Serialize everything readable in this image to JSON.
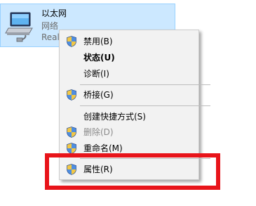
{
  "adapter": {
    "name": "以太网",
    "status": "网络",
    "device": "Real",
    "icon": "network-adapter-icon"
  },
  "context_menu": {
    "items": [
      {
        "label": "禁用(B)",
        "icon": "uac-shield-icon",
        "bold": false,
        "disabled": false
      },
      {
        "label": "状态(U)",
        "icon": null,
        "bold": true,
        "disabled": false
      },
      {
        "label": "诊断(I)",
        "icon": null,
        "bold": false,
        "disabled": false
      },
      {
        "label": "桥接(G)",
        "icon": "uac-shield-icon",
        "bold": false,
        "disabled": false
      },
      {
        "label": "创建快捷方式(S)",
        "icon": null,
        "bold": false,
        "disabled": false
      },
      {
        "label": "删除(D)",
        "icon": "uac-shield-icon",
        "bold": false,
        "disabled": true
      },
      {
        "label": "重命名(M)",
        "icon": "uac-shield-icon",
        "bold": false,
        "disabled": false
      },
      {
        "label": "属性(R)",
        "icon": "uac-shield-icon",
        "bold": false,
        "disabled": false
      }
    ]
  },
  "colors": {
    "selection_background": "#cce8ff",
    "menu_background": "#f2f2f2",
    "annotation_box": "#e8141a"
  }
}
